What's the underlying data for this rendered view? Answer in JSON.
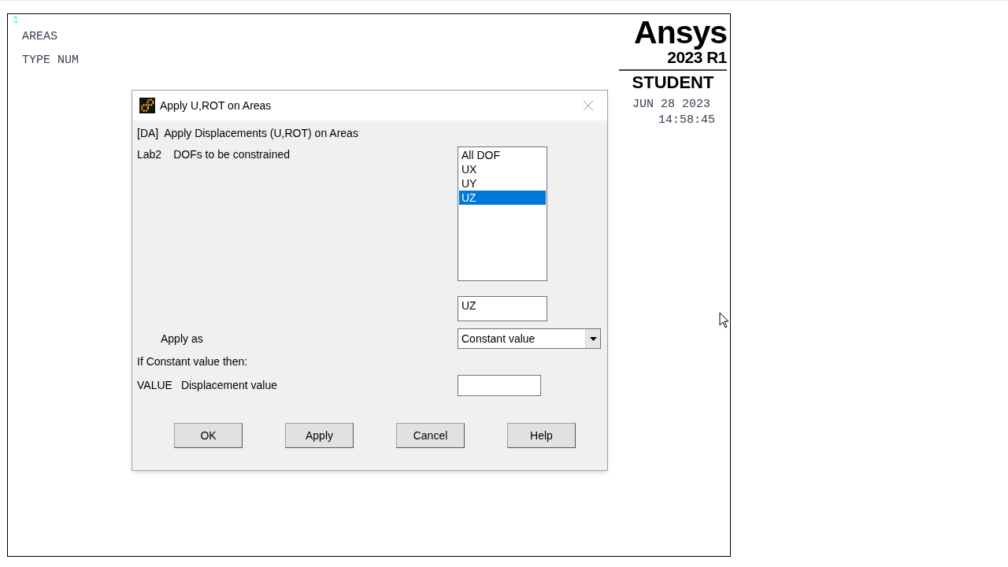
{
  "graphics": {
    "window_number": "1",
    "labels": [
      "AREAS",
      "TYPE NUM"
    ],
    "logo": {
      "brand": "Ansys",
      "version": "2023 R1",
      "edition": "STUDENT"
    },
    "date": "JUN 28 2023",
    "time": "14:58:45"
  },
  "dialog": {
    "title": "Apply U,ROT on Areas",
    "header": "[DA]  Apply Displacements (U,ROT) on Areas",
    "lab2": {
      "code": "Lab2",
      "label": "DOFs to be constrained",
      "options": [
        {
          "label": "All DOF",
          "selected": false
        },
        {
          "label": "UX",
          "selected": false
        },
        {
          "label": "UY",
          "selected": false
        },
        {
          "label": "UZ",
          "selected": true
        }
      ],
      "field_value": "UZ"
    },
    "apply_as": {
      "label": "Apply as",
      "value": "Constant value"
    },
    "constant_note": "If Constant value then:",
    "value_row": {
      "code": "VALUE",
      "label": "Displacement value"
    },
    "buttons": [
      "OK",
      "Apply",
      "Cancel",
      "Help"
    ]
  }
}
